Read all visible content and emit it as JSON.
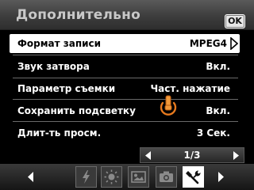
{
  "header": {
    "title": "Дополнительно",
    "ok_label": "OK"
  },
  "menu": {
    "items": [
      {
        "label": "Формат записи",
        "value": "MPEG4",
        "selected": true
      },
      {
        "label": "Звук затвора",
        "value": "Вкл."
      },
      {
        "label": "Параметр съемки",
        "value": "Част. нажатие"
      },
      {
        "label": "Сохранить подсветку",
        "value": "Вкл."
      },
      {
        "label": "Длит-ть просм.",
        "value": "3 Сек."
      }
    ]
  },
  "pager": {
    "text": "1/3"
  },
  "toolbar": {
    "tabs": [
      {
        "icon": "flash-icon"
      },
      {
        "icon": "brightness-icon"
      },
      {
        "icon": "image-settings-icon"
      },
      {
        "icon": "camera-icon"
      },
      {
        "icon": "tools-icon",
        "active": true
      }
    ]
  },
  "colors": {
    "accent": "#e87a1e",
    "selected_bg": "#ffffff",
    "header_text": "#c8c8c8"
  }
}
